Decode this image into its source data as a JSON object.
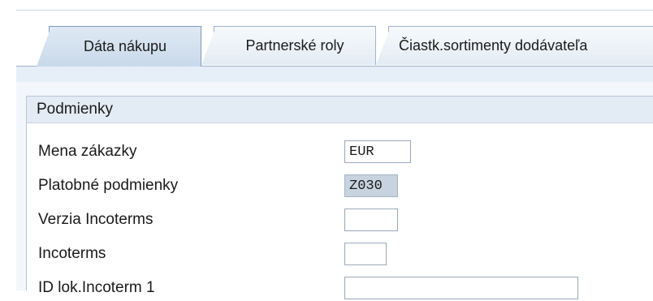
{
  "tabs": [
    {
      "label": "Dáta nákupu",
      "active": true
    },
    {
      "label": "Partnerské roly",
      "active": false
    },
    {
      "label": "Čiastk.sortimenty dodávateľa",
      "active": false
    }
  ],
  "group": {
    "title": "Podmienky",
    "rows": [
      {
        "label": "Mena zákazky",
        "value": "EUR"
      },
      {
        "label": "Platobné podmienky",
        "value": "Z030"
      },
      {
        "label": "Verzia Incoterms",
        "value": ""
      },
      {
        "label": "Incoterms",
        "value": ""
      },
      {
        "label": "ID lok.Incoterm 1",
        "value": ""
      }
    ]
  }
}
